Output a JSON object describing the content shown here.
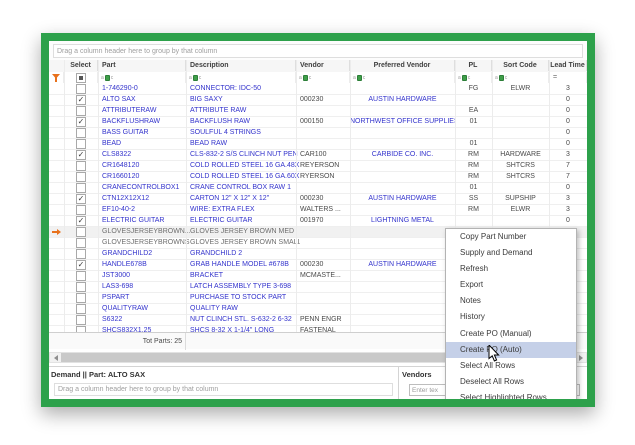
{
  "window": {
    "frame_color": "#2da14b"
  },
  "parts_grid": {
    "group_hint": "Drag a column header here to group by that column",
    "columns": [
      "Select",
      "Part",
      "Description",
      "Vendor",
      "Preferred Vendor",
      "PL",
      "Sort Code",
      "Lead Time"
    ],
    "filter_row": {
      "funnel_icon": "filter-funnel-icon",
      "select_filter": "indeterminate-checkbox",
      "text_filter_icon": "aBc-contains-icon",
      "lead_time_filter_operator": "="
    },
    "rows": [
      {
        "selected": false,
        "part": "1-746290-0",
        "description": "CONNECTOR: IDC-50",
        "vendor": "",
        "preferred_vendor": "",
        "pl": "FG",
        "sort_code": "ELWR",
        "lead_time": "3",
        "muted": false,
        "current": false
      },
      {
        "selected": true,
        "part": "ALTO SAX",
        "description": "BIG SAXY",
        "vendor": "000230",
        "preferred_vendor": "AUSTIN HARDWARE",
        "pl": "",
        "sort_code": "",
        "lead_time": "0",
        "muted": false,
        "current": false
      },
      {
        "selected": false,
        "part": "ATTRIBUTERAW",
        "description": "ATTRIBUTE RAW",
        "vendor": "",
        "preferred_vendor": "",
        "pl": "EA",
        "sort_code": "",
        "lead_time": "0",
        "muted": false,
        "current": false
      },
      {
        "selected": true,
        "part": "BACKFLUSHRAW",
        "description": "BACKFLUSH RAW",
        "vendor": "000150",
        "preferred_vendor": "NORTHWEST OFFICE SUPPLIES",
        "pl": "01",
        "sort_code": "",
        "lead_time": "0",
        "muted": false,
        "current": false
      },
      {
        "selected": false,
        "part": "BASS GUITAR",
        "description": "SOULFUL 4 STRINGS",
        "vendor": "",
        "preferred_vendor": "",
        "pl": "",
        "sort_code": "",
        "lead_time": "0",
        "muted": false,
        "current": false
      },
      {
        "selected": false,
        "part": "BEAD",
        "description": "BEAD RAW",
        "vendor": "",
        "preferred_vendor": "",
        "pl": "01",
        "sort_code": "",
        "lead_time": "0",
        "muted": false,
        "current": false
      },
      {
        "selected": true,
        "part": "CLS8322",
        "description": "CLS-832-2 S/S CLINCH NUT PEN",
        "vendor": "CAR100",
        "preferred_vendor": "CARBIDE CO. INC.",
        "pl": "RM",
        "sort_code": "HARDWARE",
        "lead_time": "3",
        "muted": false,
        "current": false
      },
      {
        "selected": false,
        "part": "CR1648120",
        "description": "COLD ROLLED STEEL 16 GA.48X120",
        "vendor": "REYERSON",
        "preferred_vendor": "",
        "pl": "RM",
        "sort_code": "SHTCRS",
        "lead_time": "7",
        "muted": false,
        "current": false
      },
      {
        "selected": false,
        "part": "CR1660120",
        "description": "COLD ROLLED STEEL 16 GA.60X120",
        "vendor": "RYERSON",
        "preferred_vendor": "",
        "pl": "RM",
        "sort_code": "SHTCRS",
        "lead_time": "7",
        "muted": false,
        "current": false
      },
      {
        "selected": false,
        "part": "CRANECONTROLBOX1",
        "description": "CRANE CONTROL BOX RAW 1",
        "vendor": "",
        "preferred_vendor": "",
        "pl": "01",
        "sort_code": "",
        "lead_time": "0",
        "muted": false,
        "current": false
      },
      {
        "selected": true,
        "part": "CTN12X12X12",
        "description": "CARTON 12\" X 12\" X 12\"",
        "vendor": "000230",
        "preferred_vendor": "AUSTIN HARDWARE",
        "pl": "SS",
        "sort_code": "SUPSHIP",
        "lead_time": "3",
        "muted": false,
        "current": false
      },
      {
        "selected": false,
        "part": "EF10-40-2",
        "description": "WIRE: EXTRA FLEX",
        "vendor": "WALTERS ...",
        "preferred_vendor": "",
        "pl": "RM",
        "sort_code": "ELWR",
        "lead_time": "3",
        "muted": false,
        "current": false
      },
      {
        "selected": true,
        "part": "ELECTRIC GUITAR",
        "description": "ELECTRIC GUITAR",
        "vendor": "001970",
        "preferred_vendor": "LIGHTNING METAL",
        "pl": "",
        "sort_code": "",
        "lead_time": "0",
        "muted": false,
        "current": false
      },
      {
        "selected": false,
        "part": "GLOVESJERSEYBROWN...",
        "description": "GLOVES JERSEY BROWN MED",
        "vendor": "",
        "preferred_vendor": "",
        "pl": "",
        "sort_code": "",
        "lead_time": "",
        "muted": true,
        "current": true
      },
      {
        "selected": false,
        "part": "GLOVESJERSEYBROWNS...",
        "description": "GLOVES JERSEY BROWN SMALL",
        "vendor": "",
        "preferred_vendor": "",
        "pl": "",
        "sort_code": "",
        "lead_time": "",
        "muted": true,
        "current": false
      },
      {
        "selected": false,
        "part": "GRANDCHILD2",
        "description": "GRANDCHILD 2",
        "vendor": "",
        "preferred_vendor": "",
        "pl": "",
        "sort_code": "",
        "lead_time": "",
        "muted": false,
        "current": false
      },
      {
        "selected": true,
        "part": "HANDLE678B",
        "description": "GRAB HANDLE MODEL #678B",
        "vendor": "000230",
        "preferred_vendor": "AUSTIN HARDWARE",
        "pl": "",
        "sort_code": "",
        "lead_time": "",
        "muted": false,
        "current": false
      },
      {
        "selected": false,
        "part": "JST3000",
        "description": "BRACKET",
        "vendor": "MCMASTE...",
        "preferred_vendor": "",
        "pl": "",
        "sort_code": "",
        "lead_time": "",
        "muted": false,
        "current": false
      },
      {
        "selected": false,
        "part": "LAS3-698",
        "description": "LATCH ASSEMBLY TYPE 3-698",
        "vendor": "",
        "preferred_vendor": "",
        "pl": "",
        "sort_code": "",
        "lead_time": "",
        "muted": false,
        "current": false
      },
      {
        "selected": false,
        "part": "PSPART",
        "description": "PURCHASE TO STOCK PART",
        "vendor": "",
        "preferred_vendor": "",
        "pl": "",
        "sort_code": "",
        "lead_time": "",
        "muted": false,
        "current": false
      },
      {
        "selected": false,
        "part": "QUALITYRAW",
        "description": "QUALITY RAW",
        "vendor": "",
        "preferred_vendor": "",
        "pl": "",
        "sort_code": "",
        "lead_time": "",
        "muted": false,
        "current": false
      },
      {
        "selected": false,
        "part": "S6322",
        "description": "NUT CLINCH STL. S-632-2 6-32",
        "vendor": "PENN ENGR",
        "preferred_vendor": "",
        "pl": "",
        "sort_code": "",
        "lead_time": "",
        "muted": false,
        "current": false
      },
      {
        "selected": false,
        "part": "SHCS832X1.25",
        "description": "SHCS 8-32 X 1-1/4\" LONG",
        "vendor": "FASTENAL",
        "preferred_vendor": "",
        "pl": "",
        "sort_code": "",
        "lead_time": "",
        "muted": false,
        "current": false
      }
    ],
    "footer_total": "Tot Parts: 25"
  },
  "demand_pane": {
    "title": "Demand || Part: ALTO SAX",
    "group_hint": "Drag a column header here to group by that column"
  },
  "vendors_pane": {
    "title": "Vendors",
    "search_placeholder": "Enter tex"
  },
  "context_menu": {
    "items": [
      "Copy Part Number",
      "Supply and Demand",
      "Refresh",
      "Export",
      "Notes",
      "History",
      "Create PO (Manual)",
      "Create PO (Auto)",
      "Select All Rows",
      "Deselect All Rows",
      "Select Highlighted Rows"
    ],
    "highlighted_item": "Create PO (Auto)",
    "highlight_color": "#c5d0e8"
  },
  "colors": {
    "frame_green": "#2da14b",
    "link_blue": "#3333cc",
    "funnel_orange": "#e8711c"
  }
}
